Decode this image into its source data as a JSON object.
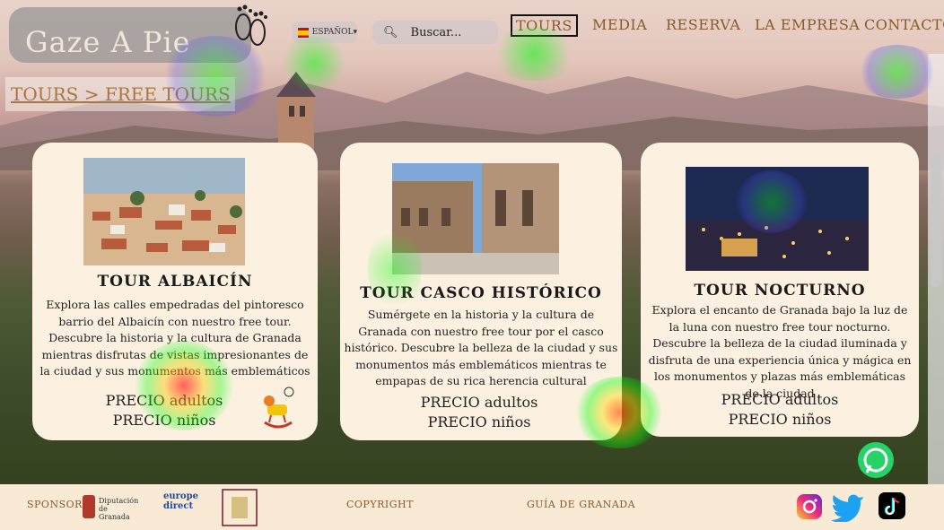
{
  "header": {
    "logo_text": "Gaze A Pie",
    "language": "ESPAÑOL▾",
    "search_placeholder": "Buscar...",
    "nav": [
      "TOURS",
      "MEDIA",
      "RESERVA",
      "LA EMPRESA",
      "CONTACTO"
    ]
  },
  "breadcrumb": "TOURS > FREE TOURS",
  "cards": [
    {
      "title": "TOUR ALBAICÍN",
      "desc": "Explora las calles empedradas del pintoresco barrio del Albaicín con nuestro free tour. Descubre la historia y la cultura de Granada mientras disfrutas de vistas impresionantes de la ciudad y sus monumentos más emblemáticos",
      "price_adults": "PRECIO adultos",
      "price_kids": "PRECIO niños"
    },
    {
      "title": "TOUR CASCO HISTÓRICO",
      "desc": "Sumérgete en la historia y la cultura de Granada con nuestro free tour por el casco histórico. Descubre la belleza de la ciudad y sus monumentos más emblemáticos mientras te empapas de su rica herencia cultural",
      "price_adults": "PRECIO adultos",
      "price_kids": "PRECIO niños"
    },
    {
      "title": "TOUR NOCTURNO",
      "desc": "Explora el encanto de Granada bajo la luz de la luna con nuestro free tour nocturno. Descubre la belleza de la ciudad iluminada y disfruta de una experiencia única y mágica en los monumentos y plazas más emblemáticas de la ciudad",
      "price_adults": "PRECIO adultos",
      "price_kids": "PRECIO niños"
    }
  ],
  "footer": {
    "sponsors": "SPONSORS",
    "diputacion": "Diputación de Granada",
    "europe_direct_line1": "europe",
    "europe_direct_line2": "direct",
    "copyright": "COPYRIGHT",
    "guia": "GUÍA DE GRANADA"
  },
  "colors": {
    "nav": "#8a5a2a",
    "card_bg": "#fcf1e1",
    "footer_bg": "#f8ead5"
  }
}
